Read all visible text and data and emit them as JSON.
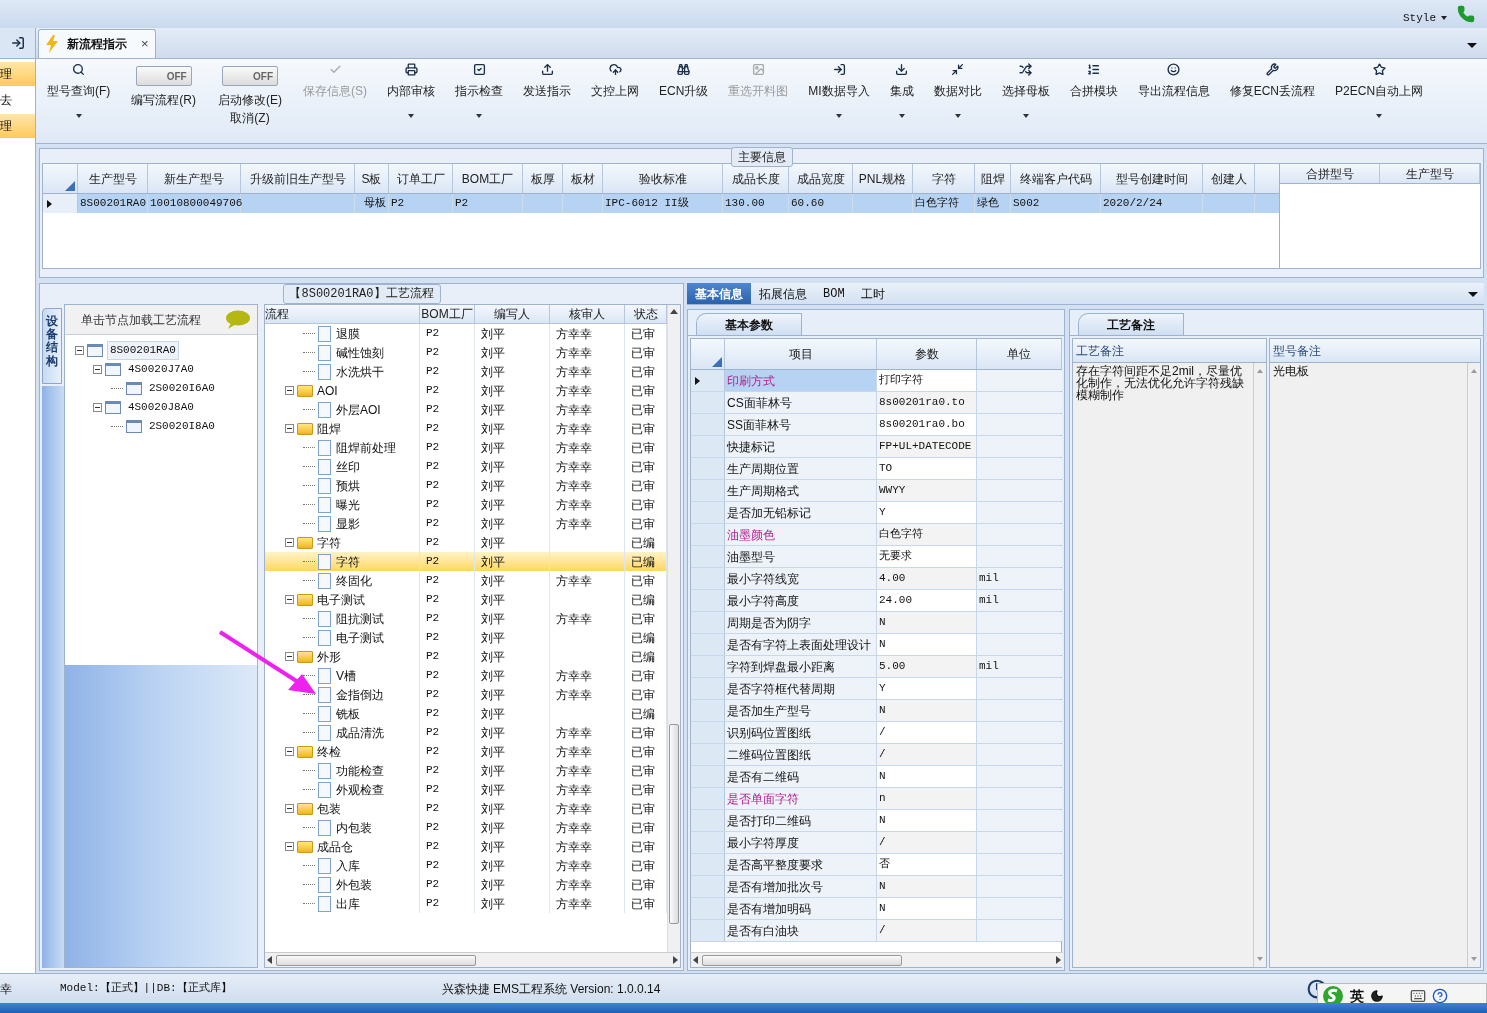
{
  "title_bar": {
    "style_menu": "Style"
  },
  "left_strip": [
    {
      "label": "理",
      "selected": true
    },
    {
      "label": "去",
      "selected": false
    },
    {
      "label": "理",
      "selected": true
    }
  ],
  "tabs": [
    {
      "label": "新流程指示",
      "selected": true,
      "close": "×"
    }
  ],
  "toolbar": [
    {
      "kind": "button",
      "label": "型号查询(F)",
      "disabled": false,
      "dropdown": true
    },
    {
      "kind": "toggle",
      "state": "OFF",
      "on": false,
      "label": "编写流程(R)"
    },
    {
      "kind": "toggle",
      "state": "OFF",
      "on": false,
      "label": "启动修改(E)",
      "sub": "取消(Z)"
    },
    {
      "kind": "button",
      "label": "保存信息(S)",
      "disabled": true,
      "dropdown": false
    },
    {
      "kind": "button",
      "label": "内部审核",
      "disabled": false,
      "dropdown": true
    },
    {
      "kind": "button",
      "label": "指示检查",
      "disabled": false,
      "dropdown": true
    },
    {
      "kind": "button",
      "label": "发送指示",
      "disabled": false,
      "dropdown": false
    },
    {
      "kind": "button",
      "label": "文控上网",
      "disabled": false,
      "dropdown": false
    },
    {
      "kind": "button",
      "label": "ECN升级",
      "disabled": false,
      "dropdown": false
    },
    {
      "kind": "button",
      "label": "重选开料图",
      "disabled": true,
      "dropdown": false
    },
    {
      "kind": "button",
      "label": "MI数据导入",
      "disabled": false,
      "dropdown": true
    },
    {
      "kind": "button",
      "label": "集成",
      "disabled": false,
      "dropdown": true
    },
    {
      "kind": "button",
      "label": "数据对比",
      "disabled": false,
      "dropdown": true
    },
    {
      "kind": "button",
      "label": "选择母板",
      "disabled": false,
      "dropdown": true
    },
    {
      "kind": "button",
      "label": "合拼模块",
      "disabled": false,
      "dropdown": false
    },
    {
      "kind": "button",
      "label": "导出流程信息",
      "disabled": false,
      "dropdown": false
    },
    {
      "kind": "button",
      "label": "修复ECN丢流程",
      "disabled": false,
      "dropdown": false
    },
    {
      "kind": "button",
      "label": "P2ECN自动上网",
      "disabled": false,
      "dropdown": true
    }
  ],
  "main_info": {
    "title": "主要信息",
    "columns": [
      "生产型号",
      "新生产型号",
      "升级前旧生产型号",
      "S板",
      "订单工厂",
      "BOM工厂",
      "板厚",
      "板材",
      "验收标准",
      "成品长度",
      "成品宽度",
      "PNL规格",
      "字符",
      "阻焊",
      "终端客户代码",
      "型号创建时间",
      "创建人"
    ],
    "rows": [
      {
        "selected": true,
        "cells": [
          "8S00201RA0",
          "10010800049706",
          null,
          "母板",
          "P2",
          "P2",
          null,
          null,
          "IPC-6012 II级",
          "130.00",
          "60.60",
          null,
          "白色字符",
          "绿色",
          "S002",
          "2020/2/24",
          null
        ]
      }
    ],
    "merge_columns": [
      "合拼型号",
      "生产型号"
    ]
  },
  "process_panel": {
    "title": "【8S00201RA0】工艺流程",
    "side_tab": "设备结构",
    "tree_header": "单击节点加载工艺流程",
    "device_tree": [
      {
        "label": "8S00201RA0",
        "selected": true,
        "children": [
          {
            "label": "4S0020J7A0",
            "selected": false,
            "children": [
              {
                "label": "2S0020I6A0",
                "selected": false
              }
            ]
          },
          {
            "label": "4S0020J8A0",
            "selected": false,
            "children": [
              {
                "label": "2S0020I8A0",
                "selected": false
              }
            ]
          }
        ]
      }
    ],
    "columns": [
      "流程",
      "BOM工厂",
      "编写人",
      "核审人",
      "状态"
    ],
    "rows": [
      {
        "children": [
          {
            "name": "退膜",
            "bom": "P2",
            "author": "刘平",
            "reviewer": "方幸幸",
            "status": "已审",
            "selected": false
          },
          {
            "name": "碱性蚀刻",
            "bom": "P2",
            "author": "刘平",
            "reviewer": "方幸幸",
            "status": "已审",
            "selected": false
          },
          {
            "name": "水洗烘干",
            "bom": "P2",
            "author": "刘平",
            "reviewer": "方幸幸",
            "status": "已审",
            "selected": false
          }
        ]
      },
      {
        "name": "AOI",
        "bom": "P2",
        "author": "刘平",
        "reviewer": "方幸幸",
        "status": "已审",
        "selected": false,
        "children": [
          {
            "name": "外层AOI",
            "bom": "P2",
            "author": "刘平",
            "reviewer": "方幸幸",
            "status": "已审",
            "selected": false
          }
        ]
      },
      {
        "name": "阻焊",
        "bom": "P2",
        "author": "刘平",
        "reviewer": "方幸幸",
        "status": "已审",
        "selected": false,
        "children": [
          {
            "name": "阻焊前处理",
            "bom": "P2",
            "author": "刘平",
            "reviewer": "方幸幸",
            "status": "已审",
            "selected": false
          },
          {
            "name": "丝印",
            "bom": "P2",
            "author": "刘平",
            "reviewer": "方幸幸",
            "status": "已审",
            "selected": false
          },
          {
            "name": "预烘",
            "bom": "P2",
            "author": "刘平",
            "reviewer": "方幸幸",
            "status": "已审",
            "selected": false
          },
          {
            "name": "曝光",
            "bom": "P2",
            "author": "刘平",
            "reviewer": "方幸幸",
            "status": "已审",
            "selected": false
          },
          {
            "name": "显影",
            "bom": "P2",
            "author": "刘平",
            "reviewer": "方幸幸",
            "status": "已审",
            "selected": false
          }
        ]
      },
      {
        "name": "字符",
        "bom": "P2",
        "author": "刘平",
        "status": "已编",
        "selected": false,
        "children": [
          {
            "name": "字符",
            "bom": "P2",
            "author": "刘平",
            "status": "已编",
            "selected": true
          },
          {
            "name": "终固化",
            "bom": "P2",
            "author": "刘平",
            "reviewer": "方幸幸",
            "status": "已审",
            "selected": false
          }
        ]
      },
      {
        "name": "电子测试",
        "bom": "P2",
        "author": "刘平",
        "status": "已编",
        "selected": false,
        "children": [
          {
            "name": "阻抗测试",
            "bom": "P2",
            "author": "刘平",
            "reviewer": "方幸幸",
            "status": "已审",
            "selected": false
          },
          {
            "name": "电子测试",
            "bom": "P2",
            "author": "刘平",
            "status": "已编",
            "selected": false
          }
        ]
      },
      {
        "name": "外形",
        "bom": "P2",
        "author": "刘平",
        "status": "已编",
        "selected": false,
        "children": [
          {
            "name": "V槽",
            "bom": "P2",
            "author": "刘平",
            "reviewer": "方幸幸",
            "status": "已审",
            "selected": false
          },
          {
            "name": "金指倒边",
            "bom": "P2",
            "author": "刘平",
            "reviewer": "方幸幸",
            "status": "已审",
            "selected": false
          },
          {
            "name": "铣板",
            "bom": "P2",
            "author": "刘平",
            "status": "已编",
            "selected": false
          },
          {
            "name": "成品清洗",
            "bom": "P2",
            "author": "刘平",
            "reviewer": "方幸幸",
            "status": "已审",
            "selected": false
          }
        ]
      },
      {
        "name": "终检",
        "bom": "P2",
        "author": "刘平",
        "reviewer": "方幸幸",
        "status": "已审",
        "selected": false,
        "children": [
          {
            "name": "功能检查",
            "bom": "P2",
            "author": "刘平",
            "reviewer": "方幸幸",
            "status": "已审",
            "selected": false
          },
          {
            "name": "外观检查",
            "bom": "P2",
            "author": "刘平",
            "reviewer": "方幸幸",
            "status": "已审",
            "selected": false
          }
        ]
      },
      {
        "name": "包装",
        "bom": "P2",
        "author": "刘平",
        "reviewer": "方幸幸",
        "status": "已审",
        "selected": false,
        "children": [
          {
            "name": "内包装",
            "bom": "P2",
            "author": "刘平",
            "reviewer": "方幸幸",
            "status": "已审",
            "selected": false
          }
        ]
      },
      {
        "name": "成品仓",
        "bom": "P2",
        "author": "刘平",
        "reviewer": "方幸幸",
        "status": "已审",
        "selected": false,
        "children": [
          {
            "name": "入库",
            "bom": "P2",
            "author": "刘平",
            "reviewer": "方幸幸",
            "status": "已审",
            "selected": false
          },
          {
            "name": "外包装",
            "bom": "P2",
            "author": "刘平",
            "reviewer": "方幸幸",
            "status": "已审",
            "selected": false
          },
          {
            "name": "出库",
            "bom": "P2",
            "author": "刘平",
            "reviewer": "方幸幸",
            "status": "已审",
            "selected": false
          }
        ]
      }
    ]
  },
  "detail_tabs": [
    {
      "label": "基本信息",
      "selected": true
    },
    {
      "label": "拓展信息",
      "selected": false
    },
    {
      "label": "BOM",
      "selected": false
    },
    {
      "label": "工时",
      "selected": false
    }
  ],
  "params": {
    "tab": "基本参数",
    "columns": [
      "项目",
      "参数",
      "单位"
    ],
    "rows": [
      {
        "item": "印刷方式",
        "value": "打印字符",
        "flagged": true,
        "selected": true
      },
      {
        "item": "CS面菲林号",
        "value": "8s00201ra0.to",
        "flagged": false,
        "selected": false
      },
      {
        "item": "SS面菲林号",
        "value": "8s00201ra0.bo",
        "flagged": false,
        "selected": false
      },
      {
        "item": "快捷标记",
        "value": "FP+UL+DATECODE",
        "flagged": false,
        "selected": false
      },
      {
        "item": "生产周期位置",
        "value": "TO",
        "flagged": false,
        "selected": false
      },
      {
        "item": "生产周期格式",
        "value": "WWYY",
        "flagged": false,
        "selected": false
      },
      {
        "item": "是否加无铅标记",
        "value": "Y",
        "flagged": false,
        "selected": false
      },
      {
        "item": "油墨颜色",
        "value": "白色字符",
        "flagged": true,
        "selected": false
      },
      {
        "item": "油墨型号",
        "value": "无要求",
        "flagged": false,
        "selected": false
      },
      {
        "item": "最小字符线宽",
        "value": "4.00",
        "unit": "mil",
        "flagged": false,
        "selected": false
      },
      {
        "item": "最小字符高度",
        "value": "24.00",
        "unit": "mil",
        "flagged": false,
        "selected": false
      },
      {
        "item": "周期是否为阴字",
        "value": "N",
        "flagged": false,
        "selected": false
      },
      {
        "item": "是否有字符上表面处理设计",
        "value": "N",
        "flagged": false,
        "selected": false
      },
      {
        "item": "字符到焊盘最小距离",
        "value": "5.00",
        "unit": "mil",
        "flagged": false,
        "selected": false
      },
      {
        "item": "是否字符框代替周期",
        "value": "Y",
        "flagged": false,
        "selected": false
      },
      {
        "item": "是否加生产型号",
        "value": "N",
        "flagged": false,
        "selected": false
      },
      {
        "item": "识别码位置图纸",
        "value": "/",
        "flagged": false,
        "selected": false
      },
      {
        "item": "二维码位置图纸",
        "value": "/",
        "flagged": false,
        "selected": false
      },
      {
        "item": "是否有二维码",
        "value": "N",
        "flagged": false,
        "selected": false
      },
      {
        "item": "是否单面字符",
        "value": "n",
        "flagged": true,
        "selected": false
      },
      {
        "item": "是否打印二维码",
        "value": "N",
        "flagged": false,
        "selected": false
      },
      {
        "item": "最小字符厚度",
        "value": "/",
        "flagged": false,
        "selected": false
      },
      {
        "item": "是否高平整度要求",
        "value": "否",
        "flagged": false,
        "selected": false
      },
      {
        "item": "是否有增加批次号",
        "value": "N",
        "flagged": false,
        "selected": false
      },
      {
        "item": "是否有增加明码",
        "value": "N",
        "flagged": false,
        "selected": false
      },
      {
        "item": "是否有白油块",
        "value": "/",
        "flagged": false,
        "selected": false
      }
    ]
  },
  "notes": {
    "tab": "工艺备注",
    "columns": [
      "工艺备注",
      "型号备注"
    ],
    "values": [
      "存在字符间距不足2mil，尽量优化制作，无法优化允许字符残缺模糊制作",
      "光电板"
    ]
  },
  "status_bar": {
    "user": "幸",
    "db": "Model:【正式】||DB:【正式库】",
    "company": "兴森快捷 EMS工程系统 Version: 1.0.0.14",
    "ime": "英"
  }
}
